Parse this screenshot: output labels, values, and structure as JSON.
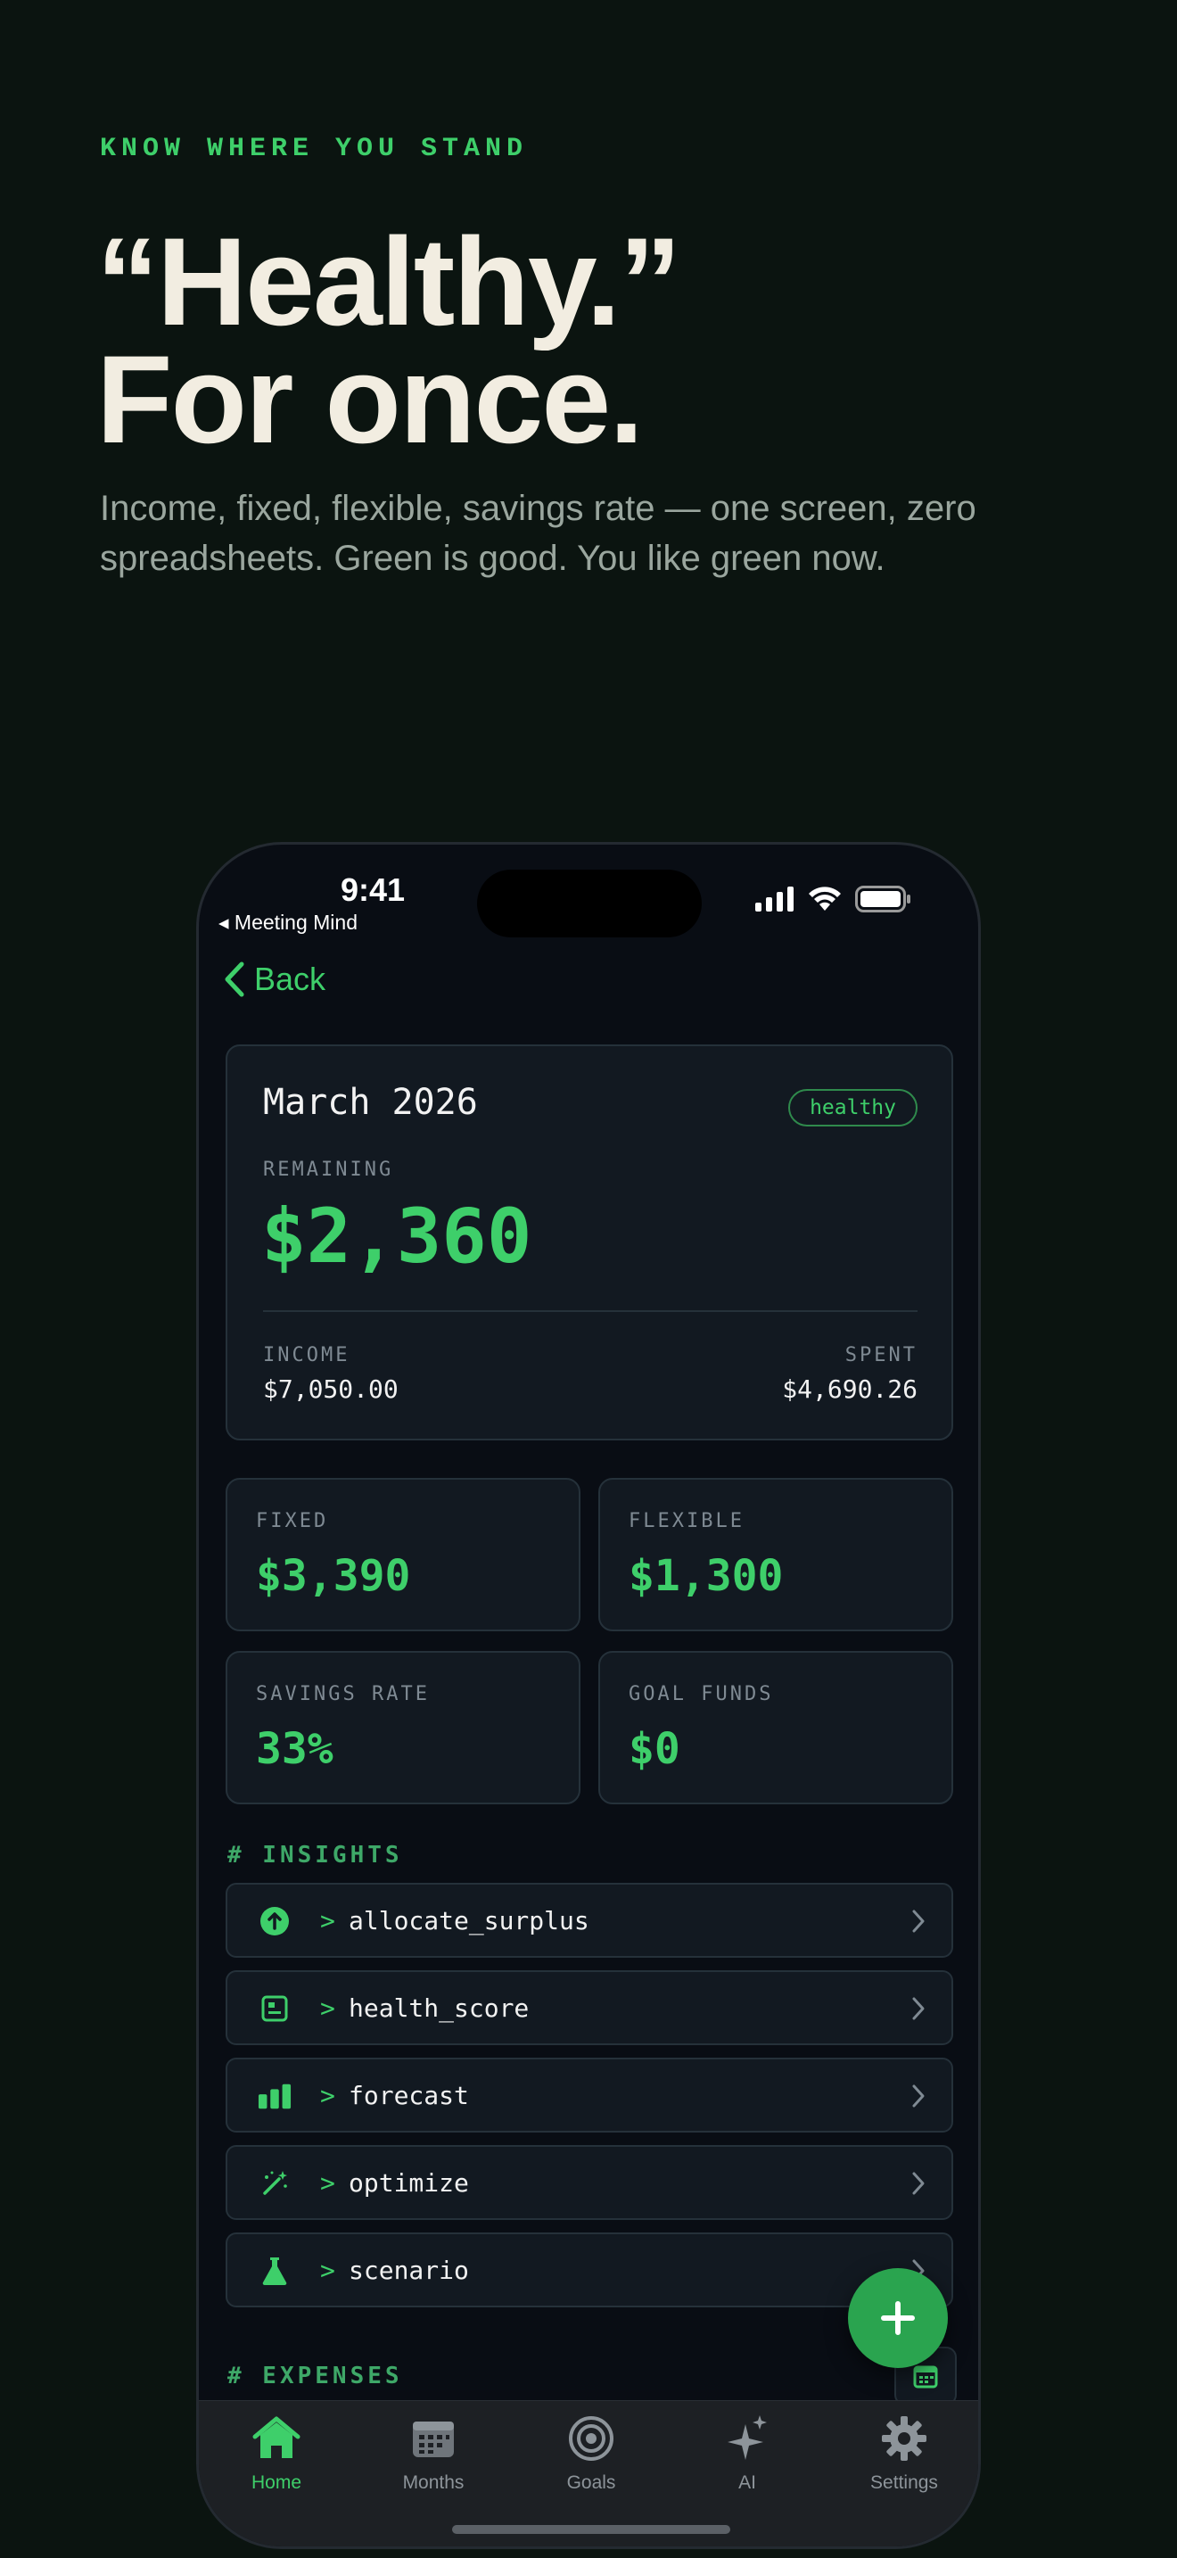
{
  "hero": {
    "eyebrow": "KNOW WHERE YOU STAND",
    "headline_line1": "“Healthy.”",
    "headline_line2": "For once.",
    "subhead": "Income, fixed, flexible, savings rate — one screen, zero spreadsheets. Green is good. You like green now."
  },
  "status_bar": {
    "time": "9:41",
    "return_app": "◂ Meeting Mind"
  },
  "nav": {
    "back_label": "Back"
  },
  "summary": {
    "month": "March 2026",
    "badge": "healthy",
    "remaining_label": "REMAINING",
    "remaining_value": "$2,360",
    "income_label": "INCOME",
    "income_value": "$7,050.00",
    "spent_label": "SPENT",
    "spent_value": "$4,690.26"
  },
  "stats": [
    {
      "label": "FIXED",
      "value": "$3,390"
    },
    {
      "label": "FLEXIBLE",
      "value": "$1,300"
    },
    {
      "label": "SAVINGS RATE",
      "value": "33%"
    },
    {
      "label": "GOAL FUNDS",
      "value": "$0"
    }
  ],
  "insights": {
    "heading": "# INSIGHTS",
    "prompt": ">",
    "items": [
      {
        "name": "allocate_surplus",
        "icon": "arrow-up-circle-icon"
      },
      {
        "name": "health_score",
        "icon": "scorecard-icon"
      },
      {
        "name": "forecast",
        "icon": "bar-chart-icon"
      },
      {
        "name": "optimize",
        "icon": "magic-wand-icon"
      },
      {
        "name": "scenario",
        "icon": "flask-icon"
      }
    ]
  },
  "expenses": {
    "heading": "# EXPENSES"
  },
  "tabs": [
    {
      "label": "Home",
      "icon": "house-icon",
      "active": true
    },
    {
      "label": "Months",
      "icon": "calendar-icon",
      "active": false
    },
    {
      "label": "Goals",
      "icon": "target-icon",
      "active": false
    },
    {
      "label": "AI",
      "icon": "sparkle-icon",
      "active": false
    },
    {
      "label": "Settings",
      "icon": "gear-icon",
      "active": false
    }
  ],
  "colors": {
    "accent": "#3ecf6a",
    "page_bg": "#0b1410",
    "phone_bg": "#090d14",
    "card_bg": "#121921",
    "headline": "#f2ede1"
  }
}
